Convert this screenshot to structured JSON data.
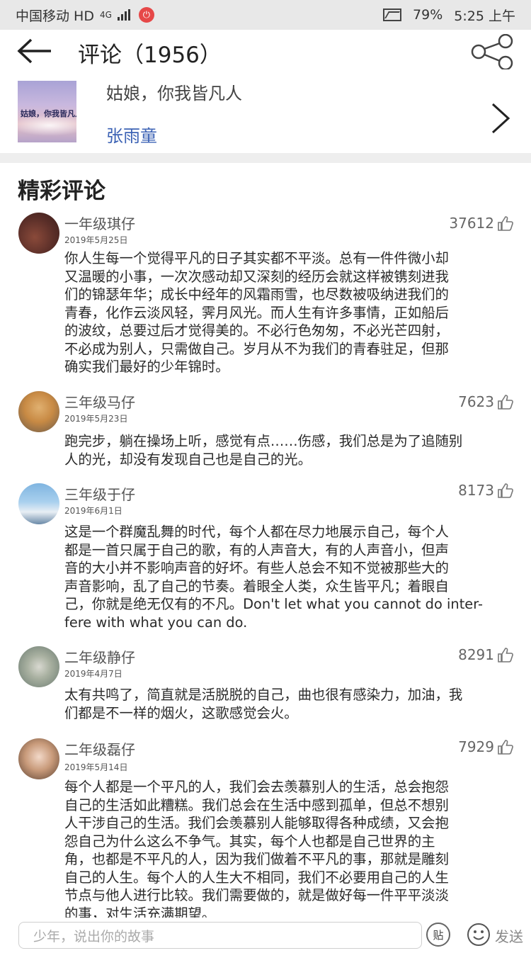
{
  "status": {
    "carrier": "中国移动 HD",
    "network": "4G",
    "battery": "79%",
    "time": "5:25 上午"
  },
  "header": {
    "title": "评论（1956）"
  },
  "song": {
    "cover_text": "姑娘，你我皆凡人",
    "name": "姑娘，你我皆凡人",
    "artist": "张雨童"
  },
  "section_title": "精彩评论",
  "comments": [
    {
      "user": "一年级琪仔",
      "date": "2019年5月25日",
      "likes": "37612",
      "text": "你人生每一个觉得平凡的日子其实都不平淡。总有一件件微小却\n又温暖的小事，一次次感动却又深刻的经历会就这样被镌刻进我\n们的锦瑟年华；成长中经年的风霜雨雪，也尽数被吸纳进我们的\n青春，化作云淡风轻，霁月风光。而人生有许多事情，正如船后\n的波纹，总要过后才觉得美的。不必行色匆匆，不必光芒四射，\n不必成为别人，只需做自己。岁月从不为我们的青春驻足，但那\n确实我们最好的少年锦时。"
    },
    {
      "user": "三年级马仔",
      "date": "2019年5月23日",
      "likes": "7623",
      "text": "跑完步，躺在操场上听，感觉有点……伤感，我们总是为了追随别\n人的光，却没有发现自己也是自己的光。"
    },
    {
      "user": "三年级于仔",
      "date": "2019年6月1日",
      "likes": "8173",
      "text": "这是一个群魔乱舞的时代，每个人都在尽力地展示自己，每个人\n都是一首只属于自己的歌，有的人声音大，有的人声音小，但声\n音的大小并不影响声音的好坏。有些人总会不知不觉被那些大的\n声音影响，乱了自己的节奏。着眼全人类，众生皆平凡；着眼自\n己，你就是绝无仅有的不凡。Don't let what you cannot do inter-\nfere with what you can do."
    },
    {
      "user": "二年级静仔",
      "date": "2019年4月7日",
      "likes": "8291",
      "text": "太有共鸣了，简直就是活脱脱的自己，曲也很有感染力，加油，我\n们都是不一样的烟火，这歌感觉会火。"
    },
    {
      "user": "二年级磊仔",
      "date": "2019年5月14日",
      "likes": "7929",
      "text": "每个人都是一个平凡的人，我们会去羡慕别人的生活，总会抱怨\n自己的生活如此糟糕。我们总会在生活中感到孤单，但总不想别\n人干涉自己的生活。我们会羡慕别人能够取得各种成绩，又会抱\n怨自己为什么这么不争气。其实，每个人也都是自己世界的主\n角，也都是不平凡的人，因为我们做着不平凡的事，那就是雕刻\n自己的人生。每个人的人生大不相同，我们不必要用自己的人生\n节点与他人进行比较。我们需要做的，就是做好每一件平平淡淡\n的事，对生活充满期望。"
    }
  ],
  "bottom": {
    "placeholder": "少年，说出你的故事",
    "sticker_label": "贴",
    "send_label": "发送"
  }
}
